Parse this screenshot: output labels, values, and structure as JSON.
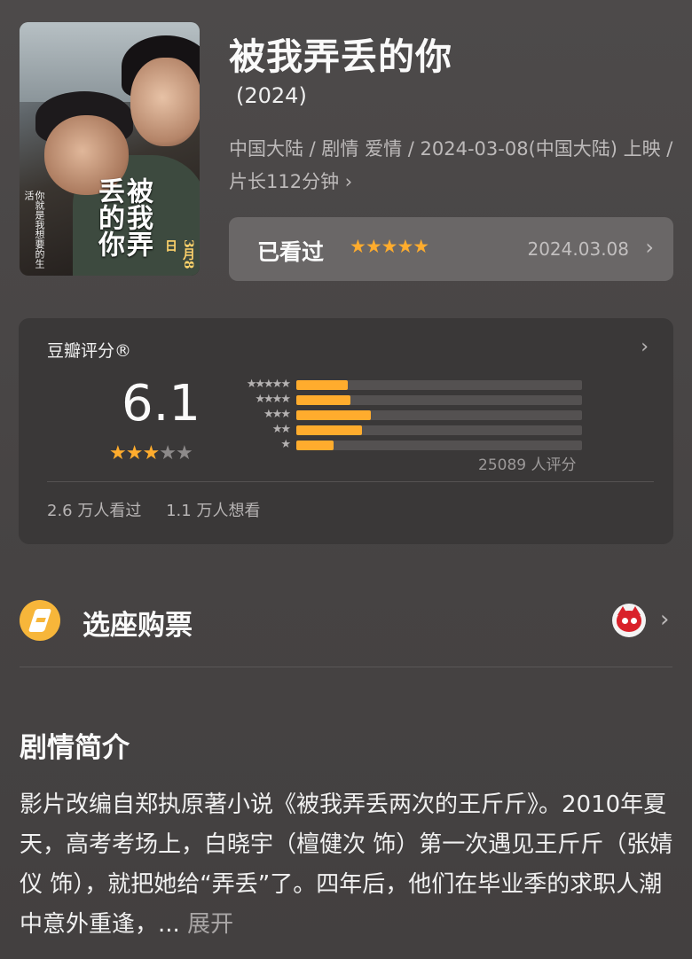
{
  "movie": {
    "title": "被我弄丢的你",
    "year": "(2024)",
    "meta": "中国大陆 / 剧情 爱情 / 2024-03-08(中国大陆) 上映 / 片长112分钟",
    "meta_chevron": "›",
    "poster": {
      "title_text": "被我弄丢的你",
      "tagline": "你就是我想要的生活",
      "date_text": "3月8日"
    }
  },
  "watched": {
    "label": "已看过",
    "user_rating_stars": 5,
    "stars_text": "★★★★★",
    "date": "2024.03.08",
    "chevron": "›"
  },
  "rating": {
    "title": "豆瓣评分®",
    "score": "6.1",
    "score_stars": 3,
    "score_stars_max": 5,
    "distribution": [
      {
        "stars": 5,
        "label": "★★★★★",
        "fraction": 0.18
      },
      {
        "stars": 4,
        "label": "★★★★",
        "fraction": 0.19
      },
      {
        "stars": 3,
        "label": "★★★",
        "fraction": 0.26
      },
      {
        "stars": 2,
        "label": "★★",
        "fraction": 0.23
      },
      {
        "stars": 1,
        "label": "★",
        "fraction": 0.13
      }
    ],
    "count": "25089 人评分",
    "watched_count": "2.6 万人看过",
    "want_count": "1.1 万人想看",
    "bar_color": "#ffac2d",
    "chevron": "›"
  },
  "ticket": {
    "label": "选座购票",
    "chevron": "›"
  },
  "synopsis": {
    "title": "剧情简介",
    "text": "影片改编自郑执原著小说《被我弄丢两次的王斤斤》。2010年夏天，高考考场上，白晓宇（檀健次 饰）第一次遇见王斤斤（张婧仪 饰），就把她给“弄丢”了。四年后，他们在毕业季的求职人潮中意外重逢，...",
    "more_label": "展开"
  }
}
